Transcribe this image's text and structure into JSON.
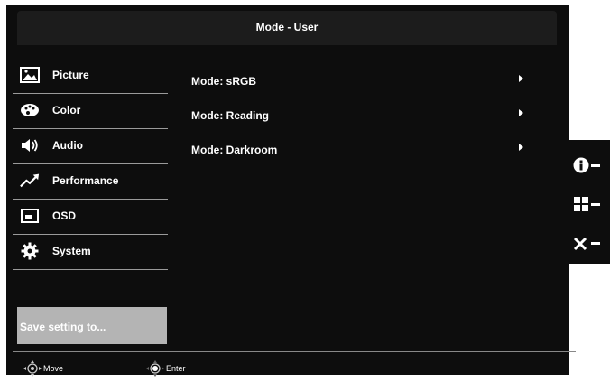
{
  "header": {
    "title": "Mode - User"
  },
  "sidebar": {
    "items": [
      {
        "label": "Picture"
      },
      {
        "label": "Color"
      },
      {
        "label": "Audio"
      },
      {
        "label": "Performance"
      },
      {
        "label": "OSD"
      },
      {
        "label": "System"
      }
    ],
    "save_label": "Save setting to..."
  },
  "submenu": {
    "items": [
      {
        "label": "Mode: sRGB"
      },
      {
        "label": "Mode: Reading"
      },
      {
        "label": "Mode: Darkroom"
      }
    ]
  },
  "footer": {
    "move_label": "Move",
    "enter_label": "Enter"
  },
  "colors": {
    "background": "#0d0d0d",
    "header": "#1c1c1c",
    "save_button": "#b4b4b4",
    "text": "#ffffff"
  }
}
